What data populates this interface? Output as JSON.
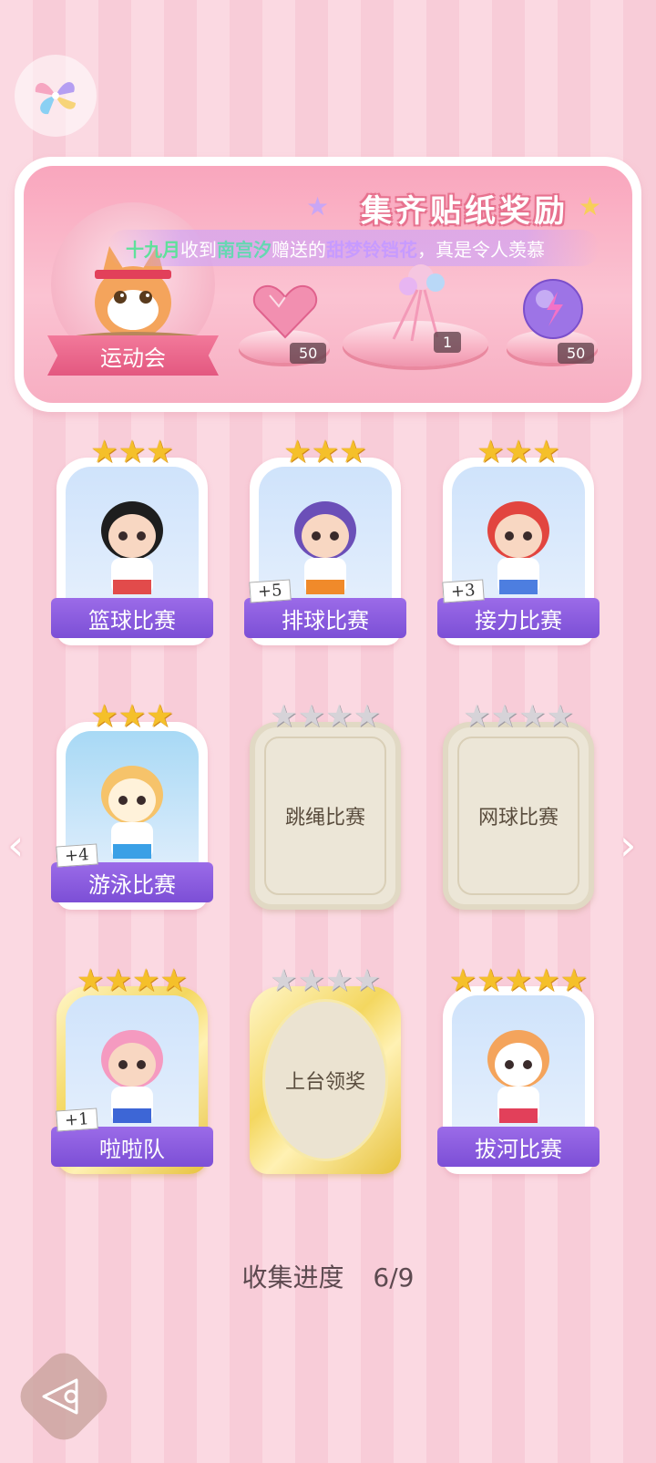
{
  "banner": {
    "title": "集齐贴纸奖励",
    "theme_label": "运动会",
    "ticker": {
      "name1": "十九月",
      "text1": "收到",
      "name2": "南宫汐",
      "text2": "赠送的",
      "item": "甜梦铃铛花",
      "text3": "，真是令人羡慕"
    },
    "rewards": [
      {
        "icon": "heart-gem-icon",
        "count": "50"
      },
      {
        "icon": "ribbon-bouquet-icon",
        "count": "1"
      },
      {
        "icon": "energy-orb-icon",
        "count": "50"
      }
    ]
  },
  "cards": [
    {
      "label": "篮球比赛",
      "stars_total": 3,
      "stars_filled": 3,
      "state": "collected",
      "badge": "",
      "art": "basketball-girl-art"
    },
    {
      "label": "排球比赛",
      "stars_total": 3,
      "stars_filled": 3,
      "state": "collected",
      "badge": "+5",
      "art": "volleyball-girl-art"
    },
    {
      "label": "接力比赛",
      "stars_total": 3,
      "stars_filled": 3,
      "state": "collected",
      "badge": "+3",
      "art": "relay-girl-art"
    },
    {
      "label": "游泳比赛",
      "stars_total": 3,
      "stars_filled": 3,
      "state": "collected",
      "badge": "+4",
      "art": "swimming-dog-art"
    },
    {
      "label": "跳绳比赛",
      "stars_total": 4,
      "stars_filled": 0,
      "state": "locked",
      "badge": "",
      "art": ""
    },
    {
      "label": "网球比赛",
      "stars_total": 4,
      "stars_filled": 0,
      "state": "locked",
      "badge": "",
      "art": ""
    },
    {
      "label": "啦啦队",
      "stars_total": 4,
      "stars_filled": 4,
      "state": "gold",
      "badge": "+1",
      "art": "cheerleader-art"
    },
    {
      "label": "上台领奖",
      "stars_total": 4,
      "stars_filled": 0,
      "state": "gold-locked",
      "badge": "",
      "art": ""
    },
    {
      "label": "拔河比赛",
      "stars_total": 5,
      "stars_filled": 5,
      "state": "collected",
      "badge": "",
      "art": "tug-of-war-cat-art"
    }
  ],
  "progress": {
    "label": "收集进度",
    "value": "6/9"
  },
  "colors": {
    "accent_purple": "#8b5cdf",
    "pink_bg": "#fbd9e2",
    "star_gold": "#f5c02a"
  }
}
